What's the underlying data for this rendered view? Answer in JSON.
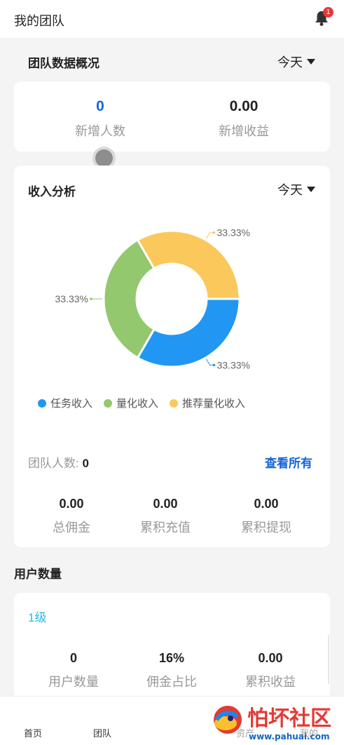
{
  "header": {
    "title": "我的团队",
    "notification_count": "1"
  },
  "overview": {
    "title": "团队数据概况",
    "period": "今天",
    "new_members": {
      "value": "0",
      "label": "新增人数"
    },
    "new_income": {
      "value": "0.00",
      "label": "新增收益"
    }
  },
  "income_analysis": {
    "title": "收入分析",
    "period": "今天",
    "team_count_label": "团队人数:",
    "team_count_value": "0",
    "view_all": "查看所有",
    "totals": [
      {
        "value": "0.00",
        "label": "总佣金"
      },
      {
        "value": "0.00",
        "label": "累积充值"
      },
      {
        "value": "0.00",
        "label": "累积提现"
      }
    ]
  },
  "chart_data": {
    "type": "pie",
    "donut": true,
    "categories": [
      "任务收入",
      "量化收入",
      "推荐量化收入"
    ],
    "values": [
      33.33,
      33.33,
      33.33
    ],
    "value_labels": [
      "33.33%",
      "33.33%",
      "33.33%"
    ],
    "colors": [
      "#2196f3",
      "#93c86f",
      "#fbc85b"
    ],
    "legend_placement": "bottom-left"
  },
  "user_count": {
    "title": "用户数量",
    "level": "1级",
    "stats": [
      {
        "value": "0",
        "label": "用户数量"
      },
      {
        "value": "16%",
        "label": "佣金占比"
      },
      {
        "value": "0.00",
        "label": "累积收益"
      }
    ]
  },
  "tabbar": {
    "items": [
      "首页",
      "团队",
      "资产",
      "我的"
    ]
  },
  "watermark": {
    "text": "怕坏社区",
    "url": "www.pahuai.com"
  }
}
